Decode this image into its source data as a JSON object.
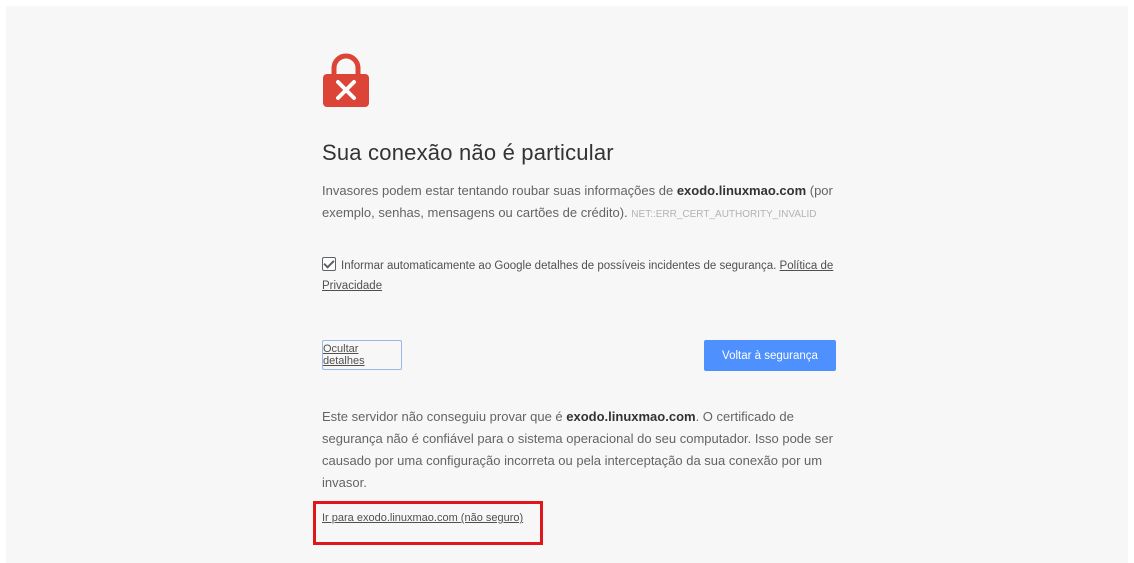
{
  "page": {
    "title": "Sua conexão não é particular",
    "icon": "lock-error-icon",
    "accent_color": "#db4437",
    "primary_color": "#4d90fe",
    "highlight_color": "#e1161d"
  },
  "description": {
    "prefix": "Invasores podem estar tentando roubar suas informações de ",
    "domain": "exodo.linuxmao.com",
    "suffix": " (por exemplo, senhas, mensagens ou cartões de crédito). ",
    "error_code": "NET::ERR_CERT_AUTHORITY_INVALID"
  },
  "report": {
    "checked": true,
    "text": "Informar automaticamente ao Google detalhes de possíveis incidentes de segurança. ",
    "privacy_link": "Política de Privacidade"
  },
  "buttons": {
    "hide_details": "Ocultar detalhes",
    "back_to_safety": "Voltar à segurança"
  },
  "details": {
    "prefix": "Este servidor não conseguiu provar que é ",
    "domain": "exodo.linuxmao.com",
    "suffix": ". O certificado de segurança não é confiável para o sistema operacional do seu computador. Isso pode ser causado por uma configuração incorreta ou pela interceptação da sua conexão por um invasor."
  },
  "proceed_link": "Ir para exodo.linuxmao.com (não seguro)"
}
